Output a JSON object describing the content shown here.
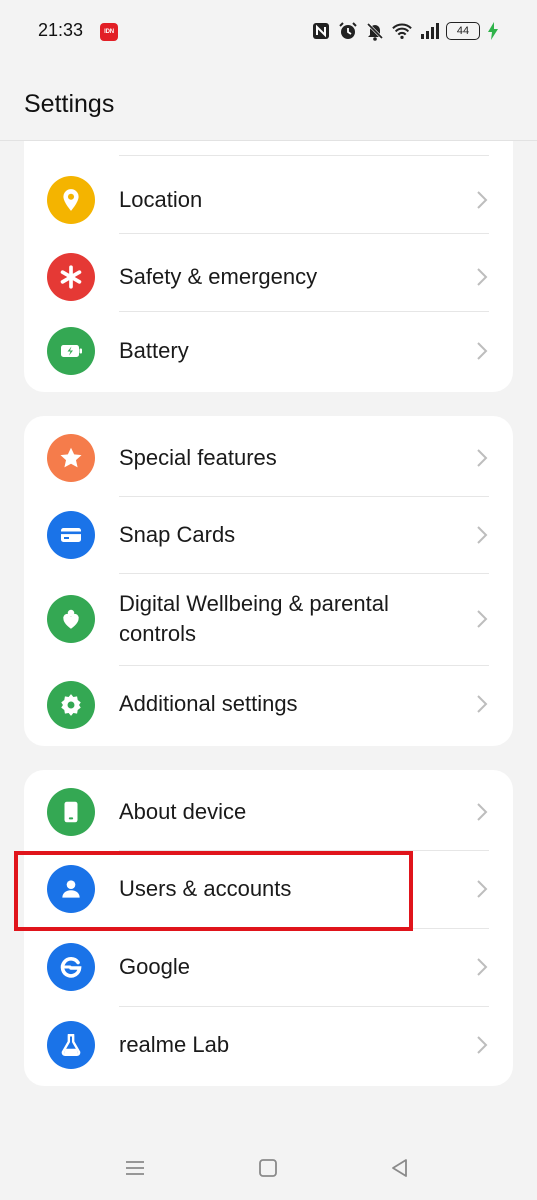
{
  "status_bar": {
    "time": "21:33",
    "notification_badge": "IDN",
    "battery_level": "44",
    "icons": [
      "nfc-icon",
      "alarm-icon",
      "mute-icon",
      "wifi-icon",
      "signal-icon",
      "battery-icon",
      "charging-icon"
    ]
  },
  "header": {
    "title": "Settings"
  },
  "groups": [
    {
      "items": [
        {
          "label": "Location",
          "icon": "location-icon",
          "color": "#f4b400"
        },
        {
          "label": "Safety & emergency",
          "icon": "asterisk-icon",
          "color": "#e53935"
        },
        {
          "label": "Battery",
          "icon": "battery-charging-icon",
          "color": "#34a853"
        }
      ]
    },
    {
      "items": [
        {
          "label": "Special features",
          "icon": "star-icon",
          "color": "#f57c4b"
        },
        {
          "label": "Snap Cards",
          "icon": "card-icon",
          "color": "#1a73e8"
        },
        {
          "label": "Digital Wellbeing & parental controls",
          "icon": "wellbeing-heart-icon",
          "color": "#34a853"
        },
        {
          "label": "Additional settings",
          "icon": "gear-icon",
          "color": "#34a853"
        }
      ]
    },
    {
      "items": [
        {
          "label": "About device",
          "icon": "phone-icon",
          "color": "#34a853"
        },
        {
          "label": "Users & accounts",
          "icon": "user-icon",
          "color": "#1a73e8"
        },
        {
          "label": "Google",
          "icon": "google-icon",
          "color": "#1a73e8"
        },
        {
          "label": "realme Lab",
          "icon": "flask-icon",
          "color": "#1a73e8"
        }
      ]
    }
  ],
  "highlight": {
    "target": "Users & accounts",
    "color": "#e0141b"
  },
  "nav_bar": {
    "buttons": [
      "menu-icon",
      "home-icon",
      "back-icon"
    ]
  }
}
